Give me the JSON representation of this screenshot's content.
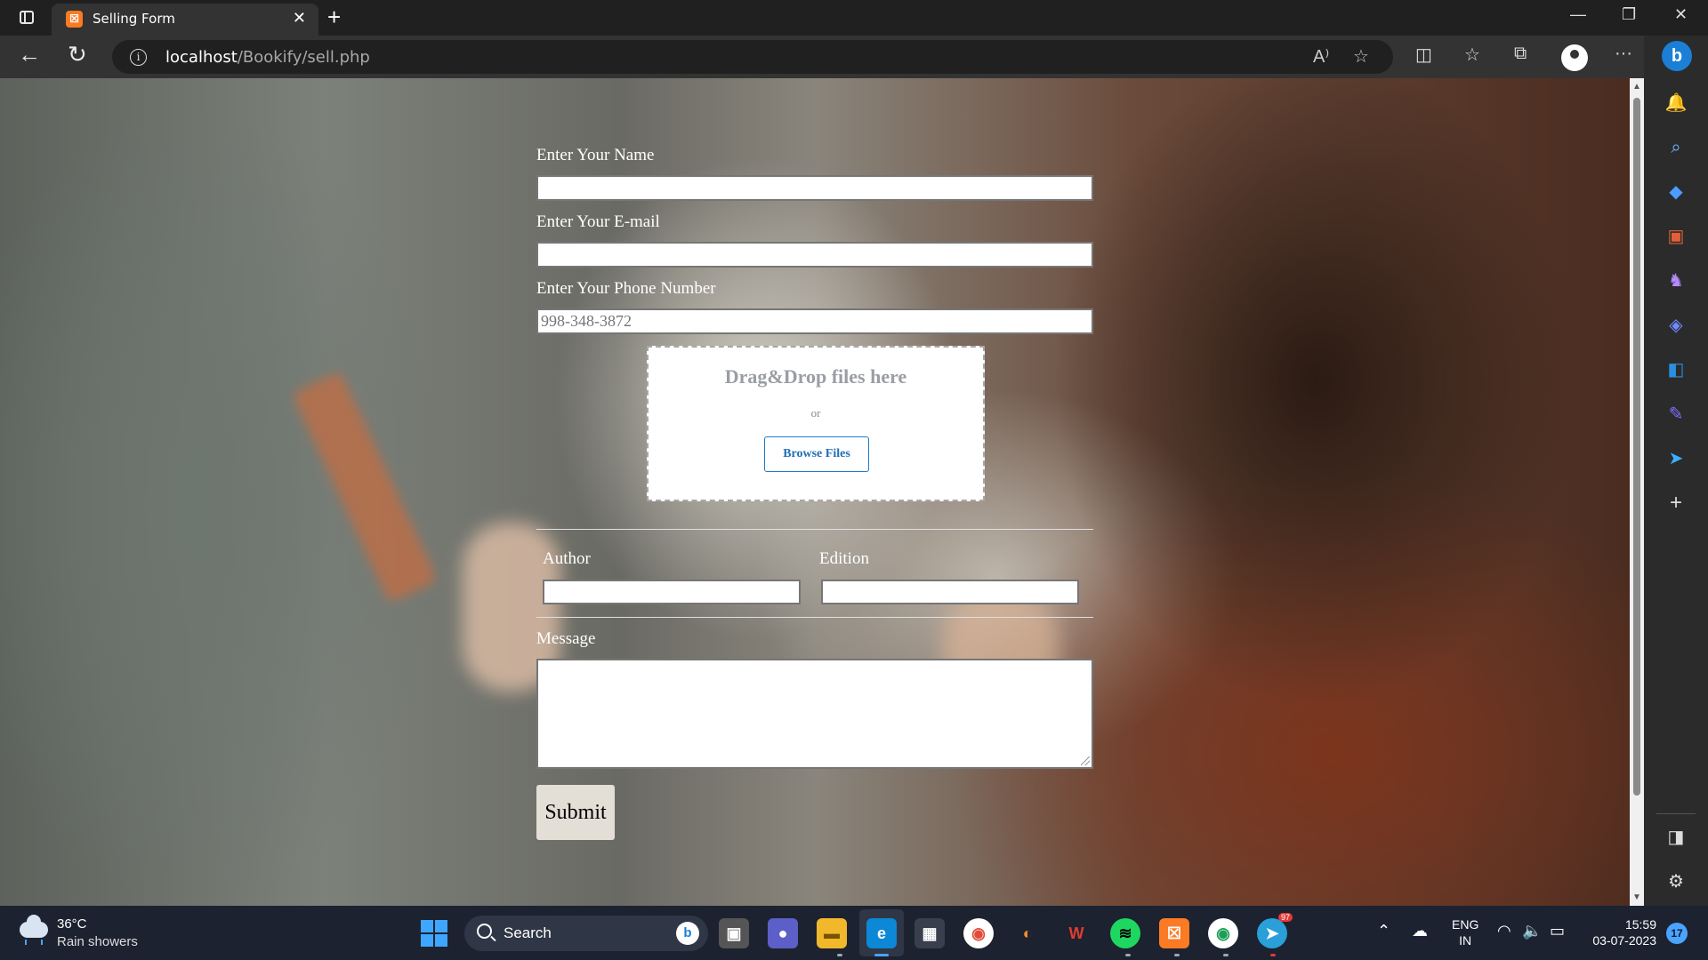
{
  "browser": {
    "tab_title": "Selling Form",
    "favicon_text": "☒",
    "new_tab": "+",
    "close_tab": "✕",
    "url_host": "localhost",
    "url_path": "/Bookify/sell.php",
    "window_controls": {
      "minimize": "—",
      "restore": "❐",
      "close": "✕"
    },
    "more_menu": "···"
  },
  "form": {
    "name_label": "Enter Your Name",
    "name_value": "",
    "email_label": "Enter Your E-mail",
    "email_value": "",
    "phone_label": "Enter Your Phone Number",
    "phone_placeholder": "998-348-3872",
    "dropzone_title": "Drag&Drop files here",
    "dropzone_or": "or",
    "browse_button": "Browse Files",
    "author_label": "Author",
    "edition_label": "Edition",
    "message_label": "Message",
    "submit_label": "Submit"
  },
  "sidebar": {
    "bing_label": "b",
    "add_label": "+"
  },
  "taskbar": {
    "temperature": "36°C",
    "weather": "Rain showers",
    "search_label": "Search",
    "lang_line1": "ENG",
    "lang_line2": "IN",
    "time": "15:59",
    "date": "03-07-2023",
    "notification_count": "17",
    "telegram_badge": "97"
  },
  "colors": {
    "accent": "#1f7ac8",
    "chrome_dark": "#202020",
    "taskbar": "#1c2230"
  }
}
